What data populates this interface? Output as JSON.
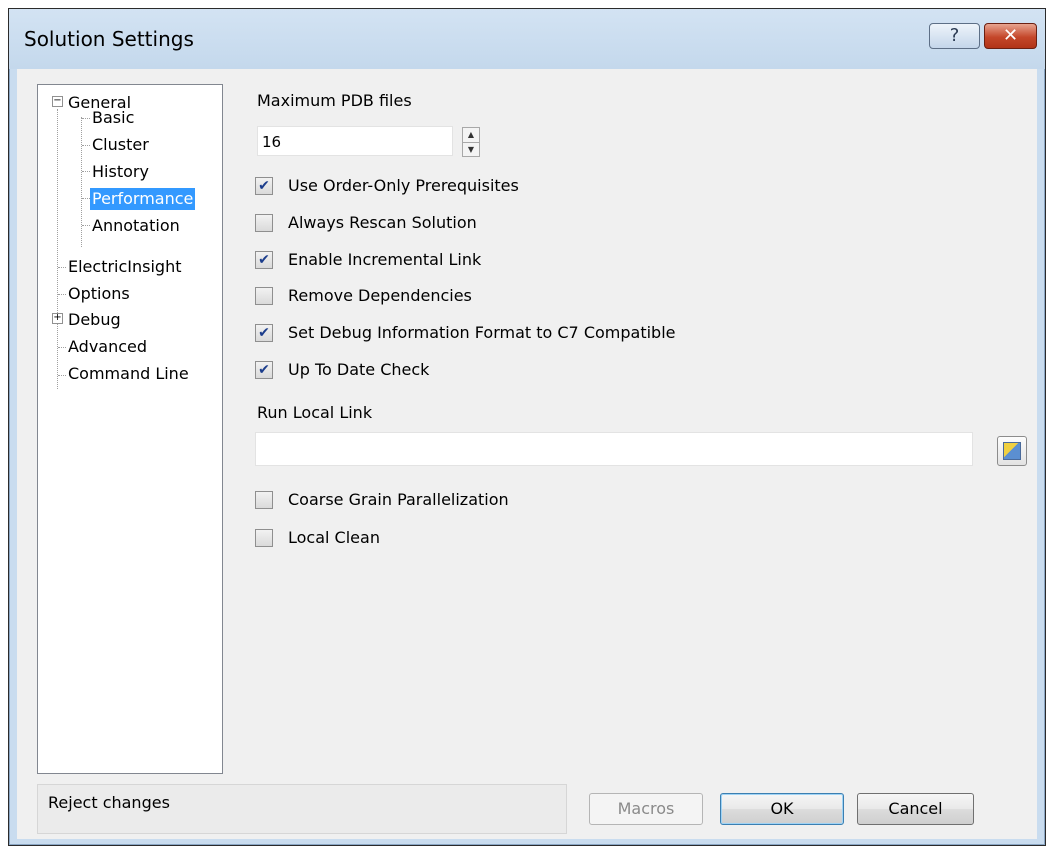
{
  "window": {
    "title": "Solution Settings",
    "help_label": "?",
    "close_label": "✕"
  },
  "tree": {
    "general": "General",
    "basic": "Basic",
    "cluster": "Cluster",
    "history": "History",
    "performance": "Performance",
    "annotation": "Annotation",
    "electricinsight": "ElectricInsight",
    "options": "Options",
    "debug": "Debug",
    "advanced": "Advanced",
    "command_line": "Command Line",
    "collapse_glyph": "−",
    "expand_glyph": "+"
  },
  "panel": {
    "max_pdb_label": "Maximum PDB files",
    "max_pdb_value": "16",
    "spin_up": "▲",
    "spin_down": "▼",
    "check_mark": "✔",
    "checkboxes": [
      {
        "label": "Use Order-Only Prerequisites",
        "checked": true
      },
      {
        "label": "Always Rescan Solution",
        "checked": false
      },
      {
        "label": "Enable Incremental Link",
        "checked": true
      },
      {
        "label": "Remove Dependencies",
        "checked": false
      },
      {
        "label": "Set Debug Information Format to C7 Compatible",
        "checked": true
      },
      {
        "label": "Up To Date Check",
        "checked": true
      }
    ],
    "run_local_link_label": "Run Local Link",
    "run_local_link_value": "",
    "checkboxes2": [
      {
        "label": "Coarse Grain Parallelization",
        "checked": false
      },
      {
        "label": "Local Clean",
        "checked": false
      }
    ]
  },
  "status": {
    "text": "Reject changes"
  },
  "buttons": {
    "macros": "Macros",
    "ok": "OK",
    "cancel": "Cancel"
  }
}
